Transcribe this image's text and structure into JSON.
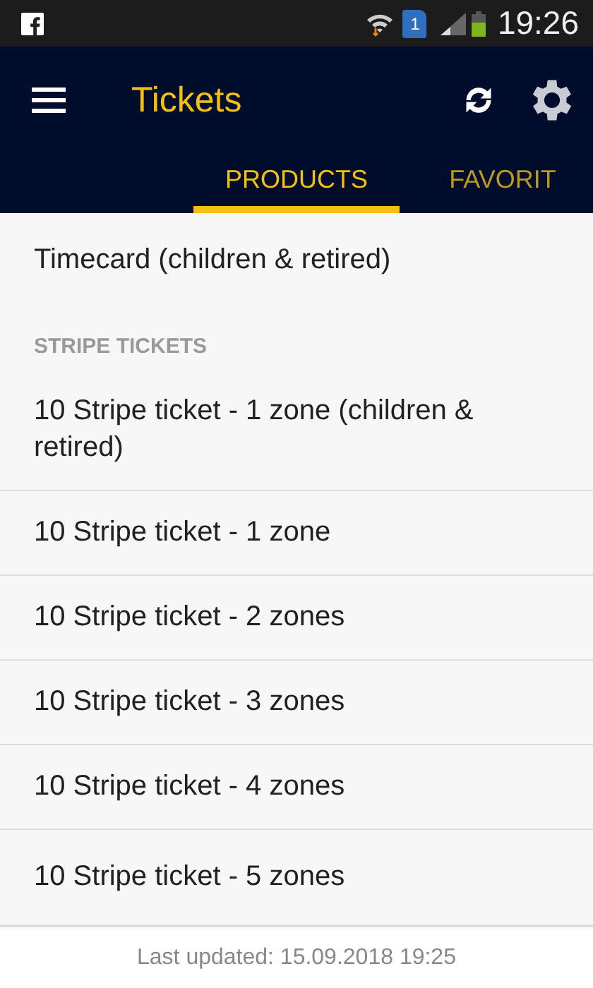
{
  "status_bar": {
    "sim_slot": "1",
    "time": "19:26"
  },
  "app_bar": {
    "title": "Tickets"
  },
  "tabs": [
    {
      "label": "PRODUCTS",
      "selected": true
    },
    {
      "label": "FAVORIT",
      "selected": false
    }
  ],
  "list": [
    {
      "kind": "item",
      "label": "Timecard (children & retired)"
    },
    {
      "kind": "header",
      "label": "STRIPE TICKETS"
    },
    {
      "kind": "item",
      "label": "10 Stripe ticket - 1 zone (children & retired)"
    },
    {
      "kind": "item",
      "label": "10 Stripe ticket - 1 zone"
    },
    {
      "kind": "item",
      "label": "10 Stripe ticket - 2 zones"
    },
    {
      "kind": "item",
      "label": "10 Stripe ticket - 3 zones"
    },
    {
      "kind": "item",
      "label": "10 Stripe ticket - 4 zones"
    },
    {
      "kind": "item",
      "label": "10 Stripe ticket - 5 zones"
    }
  ],
  "footer": {
    "text": "Last updated: 15.09.2018 19:25"
  }
}
